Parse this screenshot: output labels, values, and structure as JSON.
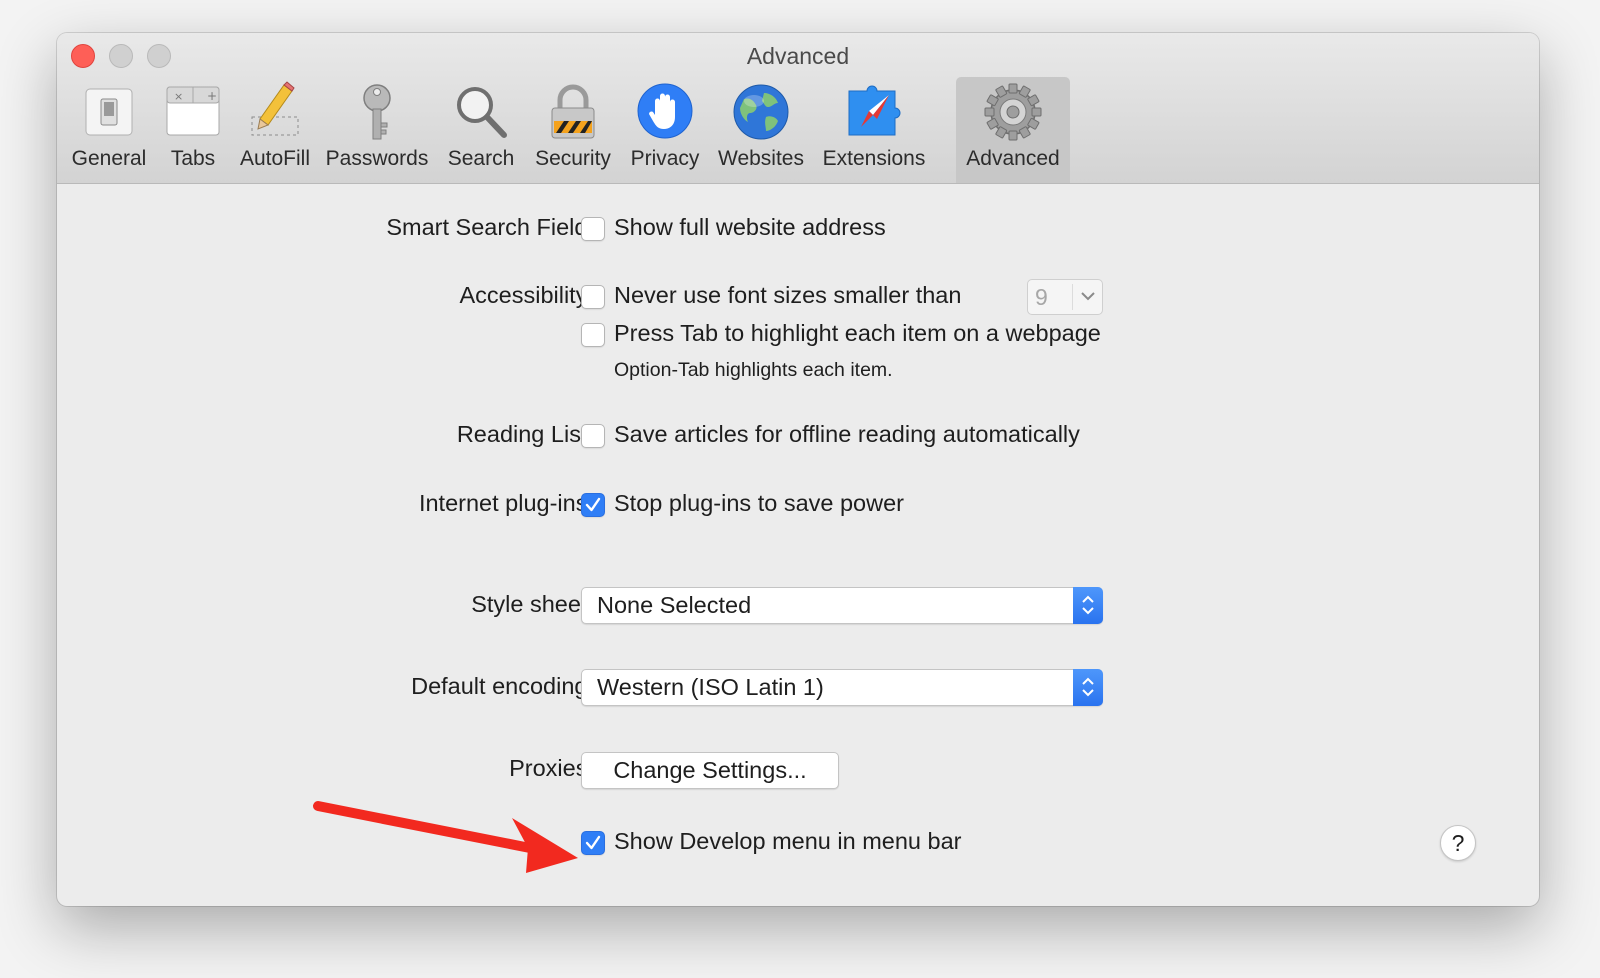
{
  "window": {
    "title": "Advanced"
  },
  "toolbar": {
    "items": [
      {
        "label": "General",
        "icon": "general-switch-icon"
      },
      {
        "label": "Tabs",
        "icon": "tabs-icon"
      },
      {
        "label": "AutoFill",
        "icon": "pencil-icon"
      },
      {
        "label": "Passwords",
        "icon": "key-icon"
      },
      {
        "label": "Search",
        "icon": "magnifier-icon"
      },
      {
        "label": "Security",
        "icon": "padlock-icon"
      },
      {
        "label": "Privacy",
        "icon": "hand-icon"
      },
      {
        "label": "Websites",
        "icon": "globe-icon"
      },
      {
        "label": "Extensions",
        "icon": "puzzle-compass-icon"
      },
      {
        "label": "Advanced",
        "icon": "gear-icon",
        "selected": true
      }
    ]
  },
  "settings": {
    "smart_search": {
      "label": "Smart Search Field:",
      "option": "Show full website address",
      "checked": false
    },
    "accessibility": {
      "label": "Accessibility:",
      "font_option": "Never use font sizes smaller than",
      "font_checked": false,
      "font_size_value": "9",
      "tab_option": "Press Tab to highlight each item on a webpage",
      "tab_checked": false,
      "tab_note": "Option-Tab highlights each item."
    },
    "reading_list": {
      "label": "Reading List:",
      "option": "Save articles for offline reading automatically",
      "checked": false
    },
    "plugins": {
      "label": "Internet plug-ins:",
      "option": "Stop plug-ins to save power",
      "checked": true
    },
    "style_sheet": {
      "label": "Style sheet:",
      "value": "None Selected"
    },
    "encoding": {
      "label": "Default encoding:",
      "value": "Western (ISO Latin 1)"
    },
    "proxies": {
      "label": "Proxies:",
      "button": "Change Settings..."
    },
    "develop_menu": {
      "option": "Show Develop menu in menu bar",
      "checked": true
    }
  },
  "help_button": "?",
  "colors": {
    "accent": "#2f7ef6",
    "annotation_arrow": "#f2291f",
    "close_button": "#fe5f57",
    "window_background": "#ececec"
  }
}
